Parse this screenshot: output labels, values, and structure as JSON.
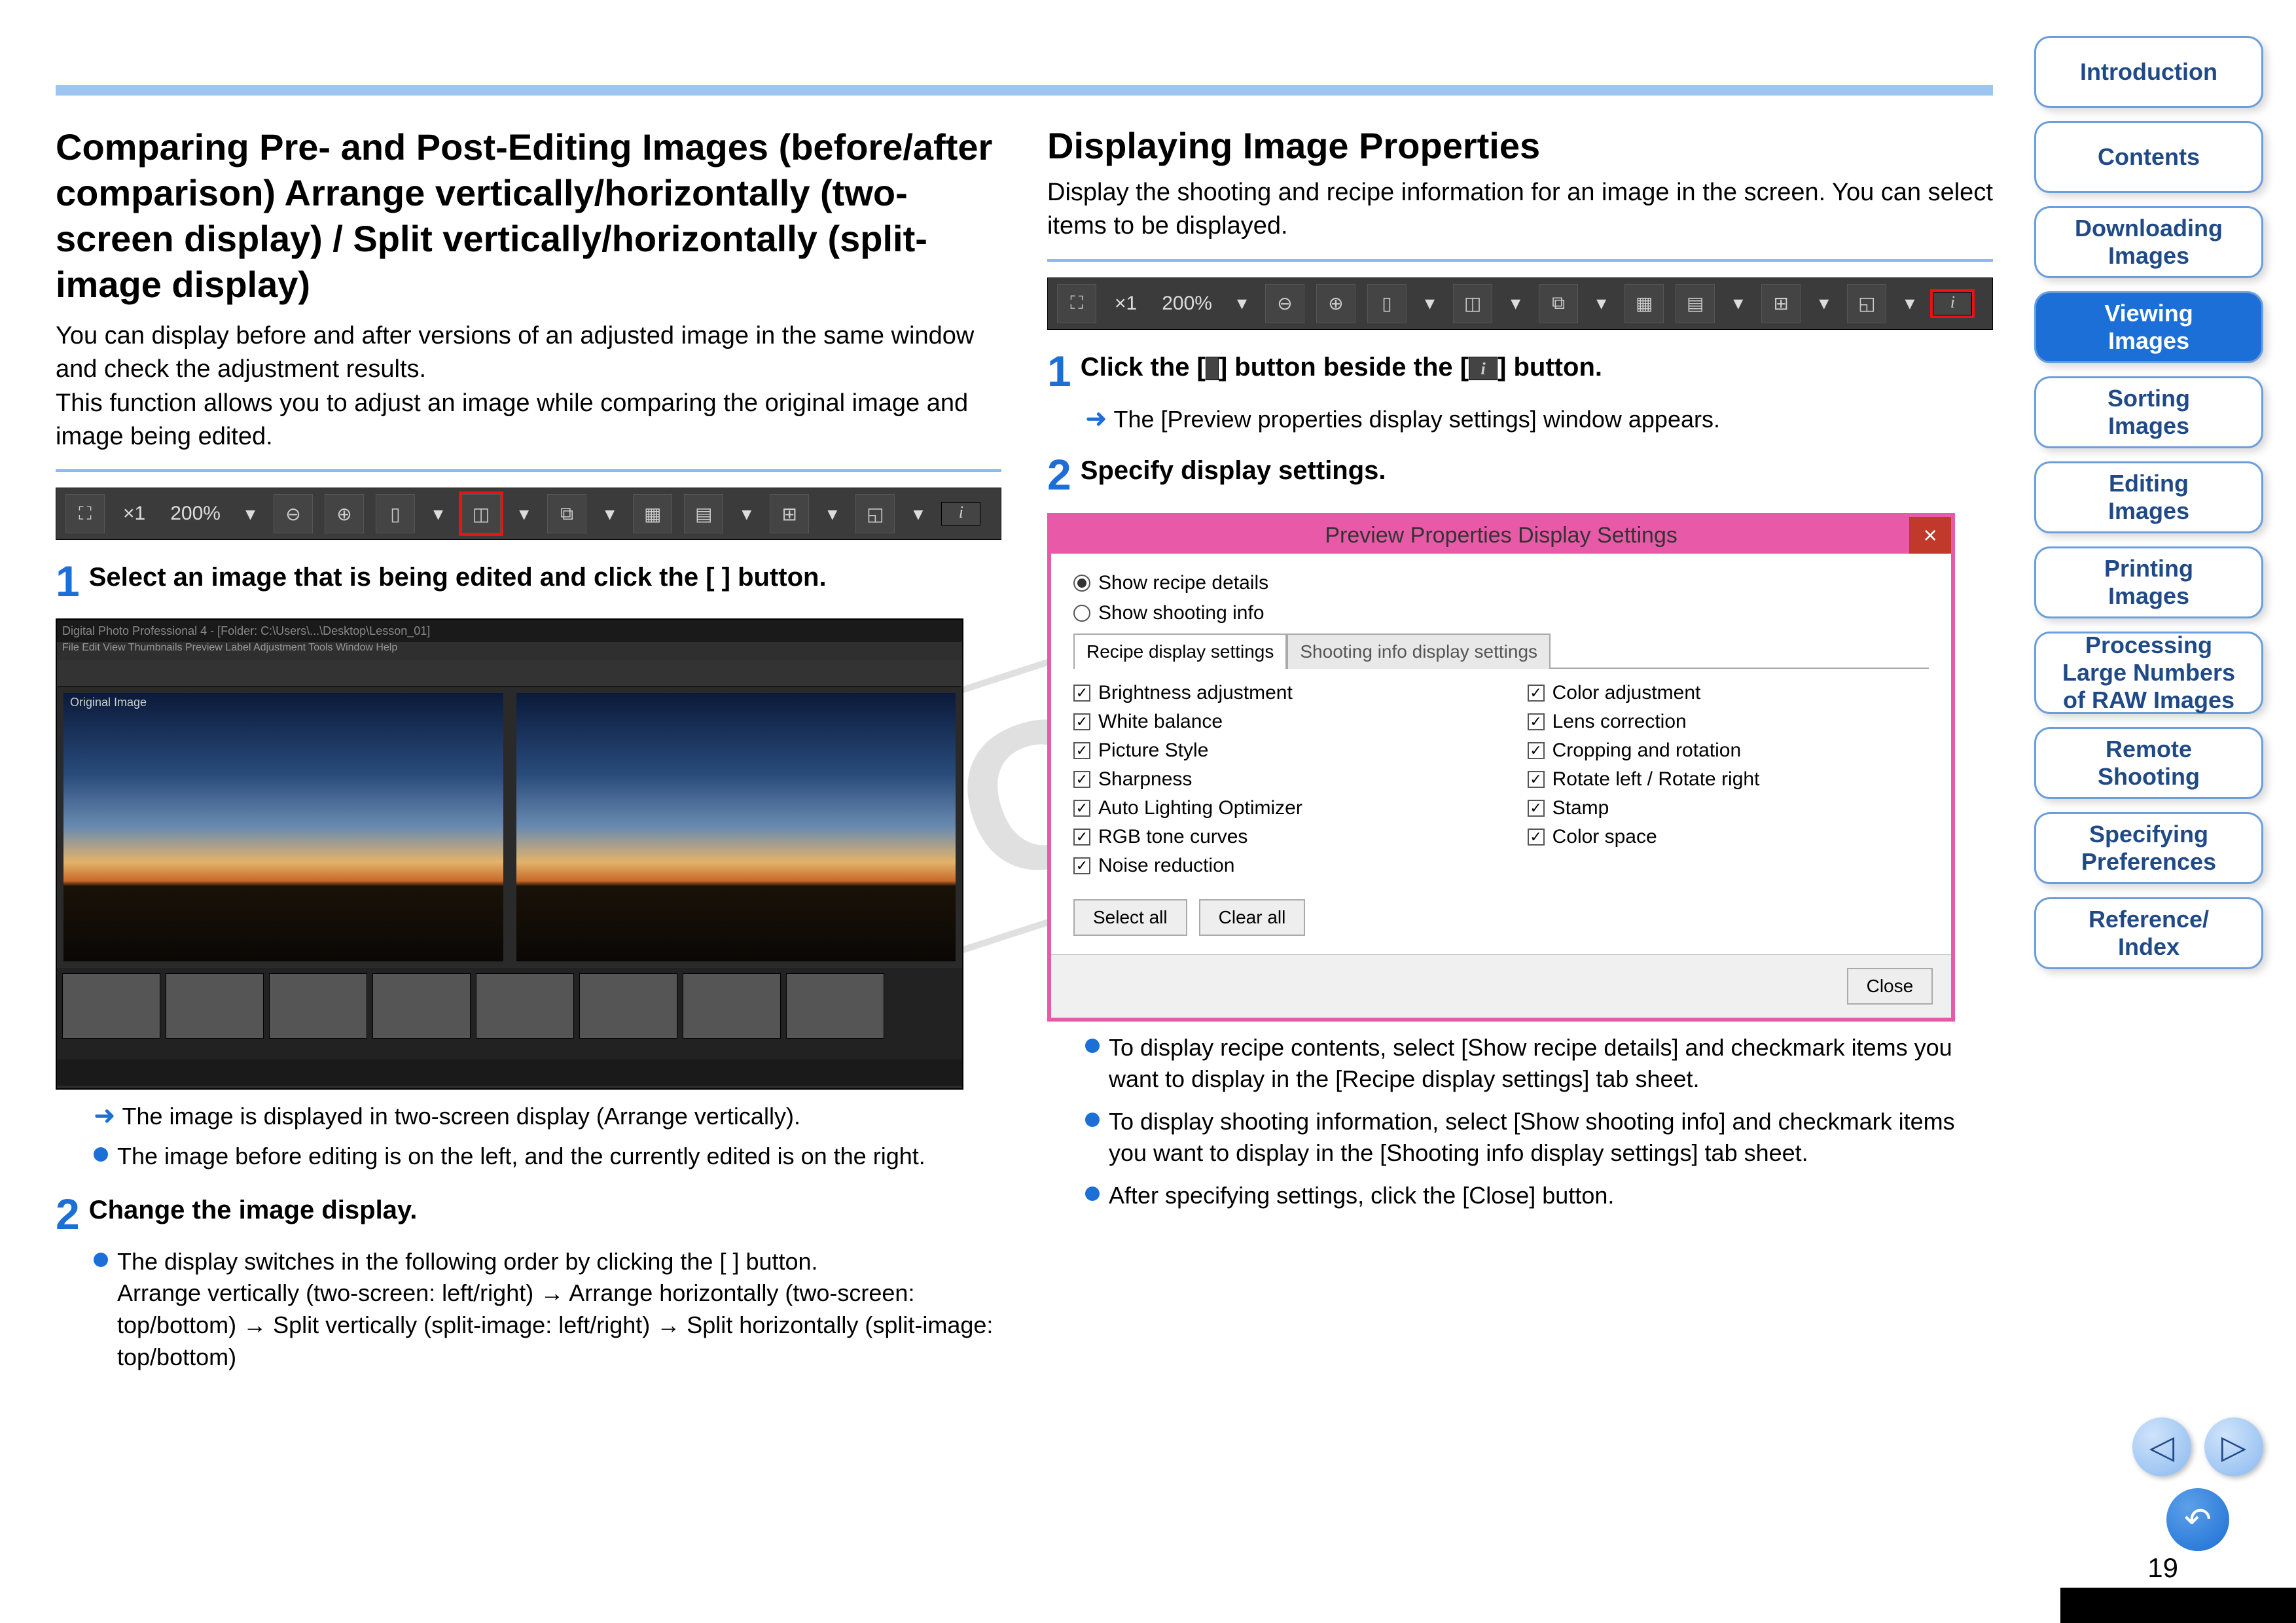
{
  "page_number": "19",
  "watermark": "COPY",
  "left": {
    "heading": "Comparing Pre- and Post-Editing Images (before/after comparison) Arrange vertically/horizontally (two-screen display) / Split vertically/horizontally (split-image display)",
    "lead": "You can display before and after versions of an adjusted image in the same window and check the adjustment results.\nThis function allows you to adjust an image while comparing the original image and image being edited.",
    "toolbar_zoom": "200%",
    "step1": "Select an image that is being edited and click the [      ] button.",
    "app_title": "Digital Photo Professional 4 - [Folder: C:\\Users\\...\\Desktop\\Lesson_01]",
    "panel_left_label": "Original Image",
    "panel_right_label": "",
    "arrow1": "The image is displayed in two-screen display (Arrange vertically).",
    "dot1": "The image before editing is on the left, and the currently edited is on the right.",
    "step2": "Change the image display.",
    "dot2": "The display switches in the following order by clicking the [     ] button.",
    "dot2_cont": "Arrange vertically (two-screen: left/right) → Arrange horizontally (two-screen: top/bottom) → Split vertically (split-image: left/right) → Split horizontally (split-image: top/bottom)"
  },
  "right": {
    "heading": "Displaying Image Properties",
    "lead": "Display the shooting and recipe information for an image in the screen. You can select items to be displayed.",
    "toolbar_zoom": "200%",
    "step1": "Click the [  ] button beside the [      ] button.",
    "arrow1": "The [Preview properties display settings] window appears.",
    "step2": "Specify display settings.",
    "dialog": {
      "title": "Preview Properties Display Settings",
      "radio1": "Show recipe details",
      "radio2": "Show shooting info",
      "tab1": "Recipe display settings",
      "tab2": "Shooting info display settings",
      "checks_left": [
        "Brightness adjustment",
        "White balance",
        "Picture Style",
        "Sharpness",
        "Auto Lighting Optimizer",
        "RGB tone curves",
        "Noise reduction"
      ],
      "checks_right": [
        "Color adjustment",
        "Lens correction",
        "Cropping and rotation",
        "Rotate left / Rotate right",
        "Stamp",
        "Color space"
      ],
      "select_all": "Select all",
      "clear_all": "Clear all",
      "close": "Close"
    },
    "dot1": "To display recipe contents, select [Show recipe details] and checkmark items you want to display in the [Recipe display settings] tab sheet.",
    "dot2": "To display shooting information, select [Show shooting info] and checkmark items you want to display in the [Shooting info display settings] tab sheet.",
    "dot3": "After specifying settings, click the [Close] button."
  },
  "sidebar": {
    "items": [
      "Introduction",
      "Contents",
      "Downloading Images",
      "Viewing Images",
      "Sorting Images",
      "Editing Images",
      "Printing Images",
      "Processing Large Numbers of RAW Images",
      "Remote Shooting",
      "Specifying Preferences",
      "Reference/ Index"
    ],
    "active_index": 3
  }
}
